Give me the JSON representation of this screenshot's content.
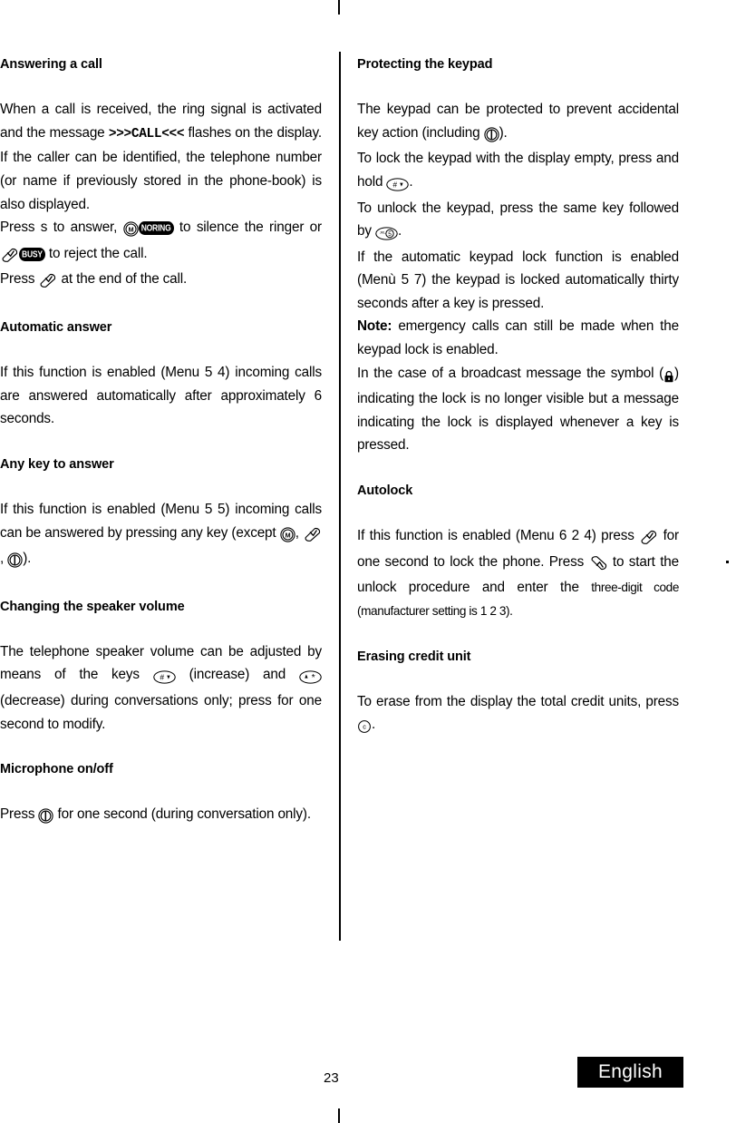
{
  "document": {
    "page_number": "23",
    "language_badge": "English"
  },
  "left_column": {
    "sections": [
      {
        "heading": "Answering a call",
        "paragraphs": [
          {
            "id": "answering-p1",
            "runs": [
              {
                "type": "text",
                "text": "When a call is received, the ring signal is activated and the message "
              },
              {
                "type": "mono",
                "text": ">>>CALL<<<"
              },
              {
                "type": "text",
                "text": " flashes on the display. If the caller can be identified, the telephone number (or name if previously stored in the phone-book) is also displayed."
              }
            ]
          },
          {
            "id": "answering-p2",
            "runs": [
              {
                "type": "text",
                "text": "Press s to answer, "
              },
              {
                "type": "icon",
                "icon": "circled-m-key"
              },
              {
                "type": "pill",
                "text": "NORING"
              },
              {
                "type": "text",
                "text": " to silence the ringer  or "
              },
              {
                "type": "icon",
                "icon": "end-call-key"
              },
              {
                "type": "pill",
                "text": "BUSY"
              },
              {
                "type": "text",
                "text": " to reject the call."
              }
            ]
          },
          {
            "id": "answering-p3",
            "runs": [
              {
                "type": "text",
                "text": "Press "
              },
              {
                "type": "icon",
                "icon": "end-call-key"
              },
              {
                "type": "text",
                "text": " at the end of the call."
              }
            ]
          }
        ]
      },
      {
        "heading": "Automatic answer",
        "paragraphs": [
          {
            "id": "auto-answer-p1",
            "runs": [
              {
                "type": "text",
                "text": "If this function is enabled (Menu 5 4) incoming calls are answered automatically after approximately 6 seconds."
              }
            ]
          }
        ]
      },
      {
        "heading": "Any key to answer",
        "paragraphs": [
          {
            "id": "any-key-p1",
            "runs": [
              {
                "type": "text",
                "text": "If this function is enabled (Menu 5 5) incoming calls can be answered by pressing any key (except "
              },
              {
                "type": "icon",
                "icon": "circled-m-key"
              },
              {
                "type": "text",
                "text": ", "
              },
              {
                "type": "icon",
                "icon": "end-call-key"
              },
              {
                "type": "text",
                "text": ", "
              },
              {
                "type": "icon",
                "icon": "power-key"
              },
              {
                "type": "text",
                "text": ")."
              }
            ]
          }
        ]
      },
      {
        "heading": "Changing the speaker volume",
        "paragraphs": [
          {
            "id": "speaker-p1",
            "runs": [
              {
                "type": "text",
                "text": "The telephone speaker volume can be adjusted by means of the keys "
              },
              {
                "type": "icon",
                "icon": "hash-up-key"
              },
              {
                "type": "text",
                "text": " (increase) and "
              },
              {
                "type": "icon",
                "icon": "star-down-key"
              },
              {
                "type": "text",
                "text": " (decrease) during conversations only; press for one second to modify."
              }
            ]
          }
        ]
      },
      {
        "heading": "Microphone on/off",
        "paragraphs": [
          {
            "id": "mic-p1",
            "runs": [
              {
                "type": "text",
                "text": "Press "
              },
              {
                "type": "icon",
                "icon": "power-key"
              },
              {
                "type": "text",
                "text": " for one second (during conversation only)."
              }
            ]
          }
        ]
      }
    ]
  },
  "right_column": {
    "sections": [
      {
        "heading": "Protecting the keypad",
        "paragraphs": [
          {
            "id": "protect-p1",
            "runs": [
              {
                "type": "text",
                "text": "The keypad can be protected to prevent accidental key action (including "
              },
              {
                "type": "icon",
                "icon": "power-key"
              },
              {
                "type": "text",
                "text": ")."
              }
            ]
          },
          {
            "id": "protect-p2",
            "runs": [
              {
                "type": "text",
                "text": "To lock the keypad with the display empty, press and hold "
              },
              {
                "type": "icon",
                "icon": "hash-up-key"
              },
              {
                "type": "text",
                "text": "."
              }
            ]
          },
          {
            "id": "protect-p3",
            "runs": [
              {
                "type": "text",
                "text": "To unlock the keypad, press the same key followed by "
              },
              {
                "type": "icon",
                "icon": "jkl5-key"
              },
              {
                "type": "text",
                "text": "."
              }
            ]
          },
          {
            "id": "protect-p4",
            "runs": [
              {
                "type": "text",
                "text": "If the automatic keypad lock function is enabled (Menù 5 7) the keypad is locked automatically thirty seconds after a key is pressed."
              }
            ]
          },
          {
            "id": "protect-p5",
            "runs": [
              {
                "type": "bold",
                "text": "Note:"
              },
              {
                "type": "text",
                "text": " emergency calls can still be made when the keypad lock is enabled."
              }
            ]
          },
          {
            "id": "protect-p6",
            "runs": [
              {
                "type": "text",
                "text": "In the case of a broadcast message the symbol ("
              },
              {
                "type": "icon",
                "icon": "padlock-icon"
              },
              {
                "type": "text",
                "text": ") indicating the lock is no longer visible but a message indicating the lock is displayed whenever a key is pressed."
              }
            ]
          }
        ]
      },
      {
        "heading": "Autolock",
        "paragraphs": [
          {
            "id": "autolock-p1",
            "runs": [
              {
                "type": "text",
                "text": "If this function is enabled (Menu  6 2 4) press "
              },
              {
                "type": "icon",
                "icon": "end-call-key"
              },
              {
                "type": "text",
                "text": " for one second to lock the phone. Press "
              },
              {
                "type": "icon",
                "icon": "send-call-key"
              },
              {
                "type": "text",
                "text": " to start the unlock procedure and enter the "
              },
              {
                "type": "small",
                "text": "three-digit code (manufacturer setting is 1 2 3)."
              }
            ]
          }
        ]
      },
      {
        "heading": "Erasing credit unit",
        "paragraphs": [
          {
            "id": "credit-p1",
            "runs": [
              {
                "type": "text",
                "text": "To erase from the display the total credit units, press "
              },
              {
                "type": "icon",
                "icon": "circled-c-key"
              },
              {
                "type": "text",
                "text": "."
              }
            ]
          }
        ]
      }
    ]
  },
  "icons": {
    "circled-m-key": "circled-m-key",
    "end-call-key": "end-call-key",
    "send-call-key": "send-call-key",
    "power-key": "power-key",
    "hash-up-key": "hash-up-key",
    "star-down-key": "star-down-key",
    "jkl5-key": "jkl5-key",
    "padlock-icon": "padlock-icon",
    "circled-c-key": "circled-c-key"
  },
  "colors": {
    "ink": "#000000",
    "paper": "#ffffff",
    "badge_bg": "#000000",
    "badge_text": "#ffffff"
  }
}
